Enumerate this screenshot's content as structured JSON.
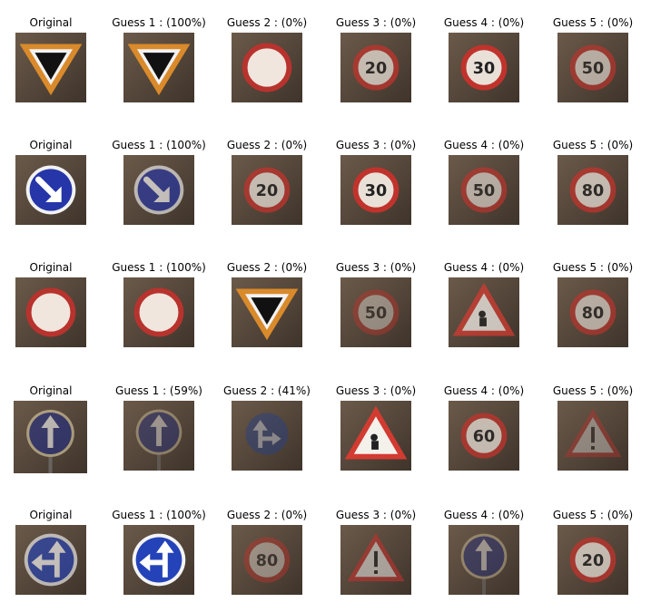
{
  "rows": [
    {
      "cells": [
        {
          "title": "Original",
          "scene": "yield",
          "variant": "bright"
        },
        {
          "title": "Guess 1 : (100%)",
          "scene": "yield",
          "variant": "dark-sky"
        },
        {
          "title": "Guess 2 : (0%)",
          "scene": "no-vehicles",
          "variant": "gray"
        },
        {
          "title": "Guess 3 : (0%)",
          "scene": "speed-limit-20",
          "variant": "dim"
        },
        {
          "title": "Guess 4 : (0%)",
          "scene": "speed-limit-30",
          "variant": "bright"
        },
        {
          "title": "Guess 5 : (0%)",
          "scene": "speed-limit-50",
          "variant": "dark"
        }
      ]
    },
    {
      "cells": [
        {
          "title": "Original",
          "scene": "keep-right",
          "variant": "orange"
        },
        {
          "title": "Guess 1 : (100%)",
          "scene": "keep-right",
          "variant": "dark"
        },
        {
          "title": "Guess 2 : (0%)",
          "scene": "speed-limit-20",
          "variant": "dim"
        },
        {
          "title": "Guess 3 : (0%)",
          "scene": "speed-limit-30",
          "variant": "bright"
        },
        {
          "title": "Guess 4 : (0%)",
          "scene": "speed-limit-50",
          "variant": "dark"
        },
        {
          "title": "Guess 5 : (0%)",
          "scene": "speed-limit-80",
          "variant": "dim"
        }
      ]
    },
    {
      "cells": [
        {
          "title": "Original",
          "scene": "no-vehicles",
          "variant": "warm-blur"
        },
        {
          "title": "Guess 1 : (100%)",
          "scene": "no-vehicles",
          "variant": "gray"
        },
        {
          "title": "Guess 2 : (0%)",
          "scene": "yield",
          "variant": "dark-sky"
        },
        {
          "title": "Guess 3 : (0%)",
          "scene": "speed-limit-50",
          "variant": "very-dark"
        },
        {
          "title": "Guess 4 : (0%)",
          "scene": "road-work",
          "variant": "dim"
        },
        {
          "title": "Guess 5 : (0%)",
          "scene": "speed-limit-80",
          "variant": "dark"
        }
      ]
    },
    {
      "cells": [
        {
          "title": "Original",
          "scene": "go-straight",
          "variant": "dark"
        },
        {
          "title": "Guess 1 : (59%)",
          "scene": "go-straight",
          "variant": "very-dark"
        },
        {
          "title": "Guess 2 : (41%)",
          "scene": "straight-or-right",
          "variant": "very-dark"
        },
        {
          "title": "Guess 3 : (0%)",
          "scene": "road-work",
          "variant": "bright"
        },
        {
          "title": "Guess 4 : (0%)",
          "scene": "speed-limit-60",
          "variant": "dim"
        },
        {
          "title": "Guess 5 : (0%)",
          "scene": "warning",
          "variant": "very-dark"
        }
      ]
    },
    {
      "cells": [
        {
          "title": "Original",
          "scene": "straight-or-left",
          "variant": "dark"
        },
        {
          "title": "Guess 1 : (100%)",
          "scene": "straight-or-left",
          "variant": "bright"
        },
        {
          "title": "Guess 2 : (0%)",
          "scene": "speed-limit-80",
          "variant": "very-dark"
        },
        {
          "title": "Guess 3 : (0%)",
          "scene": "warning",
          "variant": "dark"
        },
        {
          "title": "Guess 4 : (0%)",
          "scene": "go-straight",
          "variant": "very-dark"
        },
        {
          "title": "Guess 5 : (0%)",
          "scene": "speed-limit-20",
          "variant": "dim"
        }
      ]
    }
  ]
}
